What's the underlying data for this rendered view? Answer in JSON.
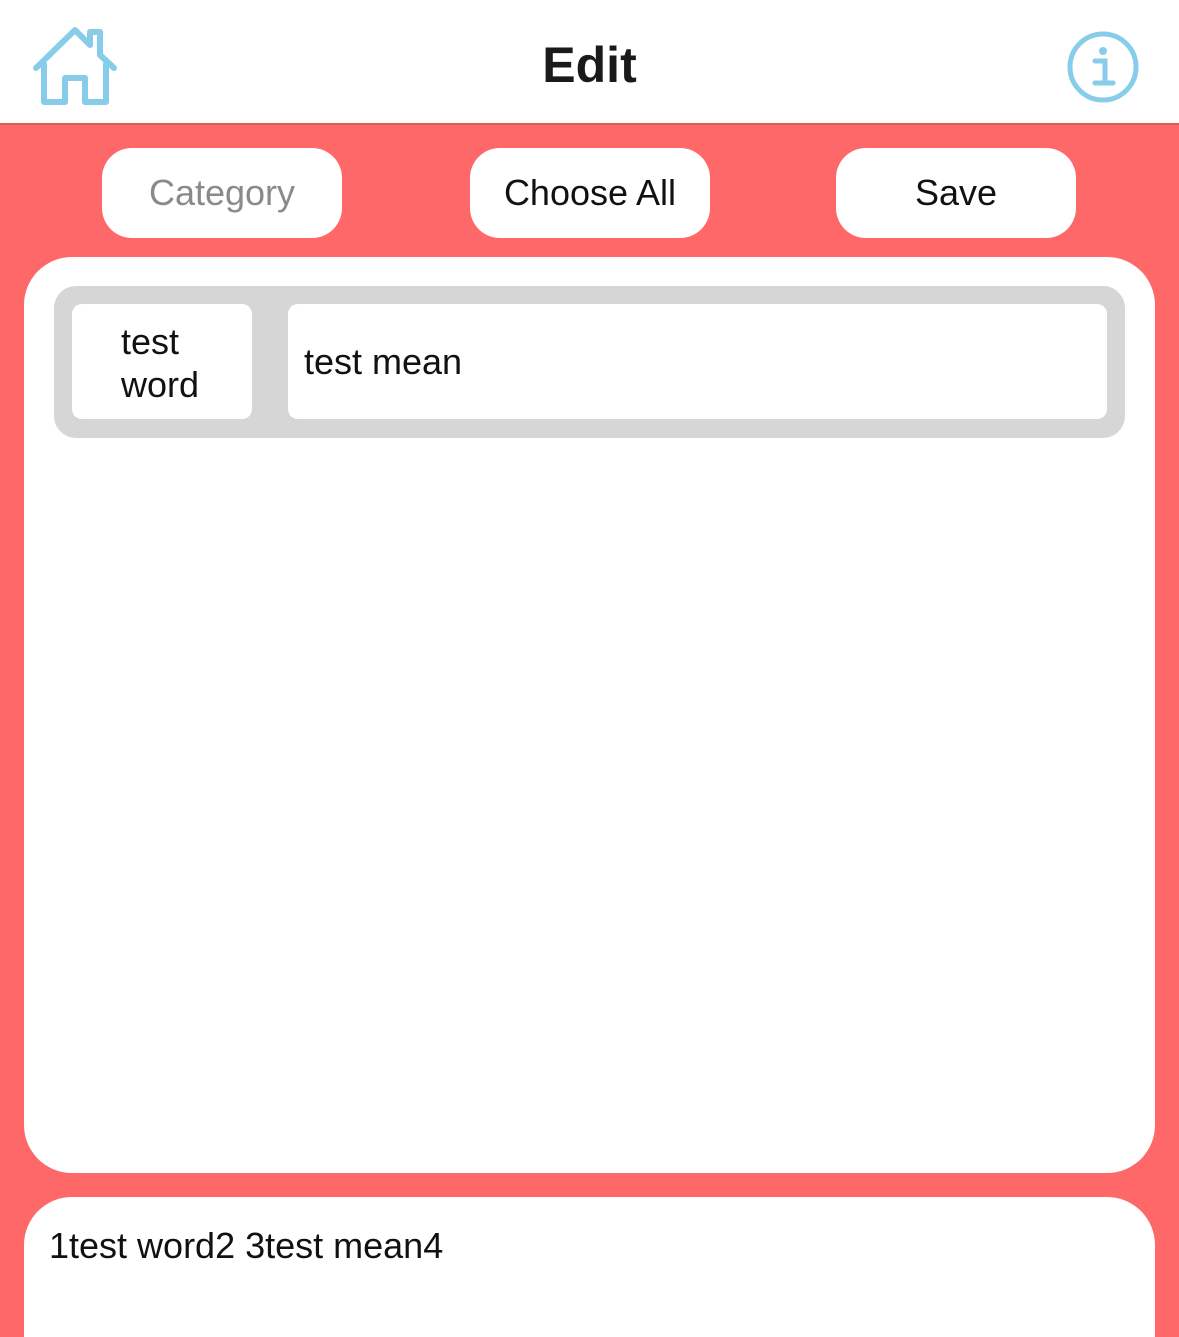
{
  "navbar": {
    "title": "Edit",
    "home_icon": "home-icon",
    "info_icon": "info-icon",
    "icon_color": "#87cdea"
  },
  "toolbar": {
    "category_label": "Category",
    "choose_all_label": "Choose All",
    "save_label": "Save"
  },
  "theme": {
    "accent": "#ff6868",
    "row_bg": "#d6d6d6"
  },
  "words": [
    {
      "word_line1": "test",
      "word_line2": "word",
      "mean": "test mean"
    }
  ],
  "preview": {
    "text": "1test word2 3test mean4"
  }
}
